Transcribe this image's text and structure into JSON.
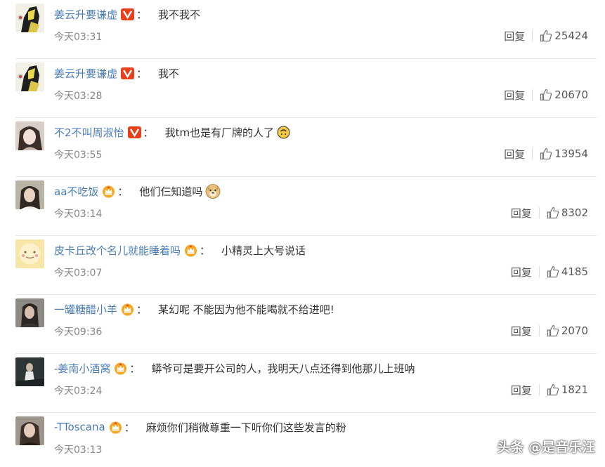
{
  "comments": [
    {
      "name": "姜云升要谦虚",
      "badge": "v-icon",
      "text": "我不我不",
      "emoji": "",
      "time": "今天03:31",
      "reply": "回复",
      "likes": "25424"
    },
    {
      "name": "姜云升要谦虚",
      "badge": "v-icon",
      "text": "我不",
      "emoji": "",
      "time": "今天03:28",
      "reply": "回复",
      "likes": "20670"
    },
    {
      "name": "不2不叫周淑怡",
      "badge": "v-icon",
      "text": "我tm也是有厂牌的人了",
      "emoji": "upside-down-face-icon",
      "time": "今天03:55",
      "reply": "回复",
      "likes": "13954"
    },
    {
      "name": "aa不吃饭",
      "badge": "crown-icon",
      "text": "他们仨知道吗",
      "emoji": "doge-icon",
      "time": "今天03:14",
      "reply": "回复",
      "likes": "8302"
    },
    {
      "name": "皮卡丘改个名儿就能睡着吗",
      "badge": "crown-icon",
      "text": "小精灵上大号说话",
      "emoji": "",
      "time": "今天03:07",
      "reply": "回复",
      "likes": "4185"
    },
    {
      "name": "一罐糖醋小羊",
      "badge": "crown-icon",
      "text": "某幻呢 不能因为他不能喝就不给进吧!",
      "emoji": "",
      "time": "今天09:36",
      "reply": "回复",
      "likes": "2070"
    },
    {
      "name": "-姜南小酒窝",
      "badge": "crown-icon",
      "text": "蟒爷可是要开公司的人，我明天八点还得到他那儿上班呐",
      "emoji": "",
      "time": "今天03:24",
      "reply": "回复",
      "likes": "1821"
    },
    {
      "name": "-TToscana",
      "badge": "crown-icon",
      "text": "麻烦你们稍微尊重一下听你们这些发言的粉",
      "emoji": "",
      "time": "今天03:13",
      "reply": "",
      "likes": ""
    }
  ],
  "colon": "：",
  "watermark": "头条 @是音乐汪",
  "colors": {
    "name": "#4a7db8",
    "badge_v": "#e8401c",
    "crown": "#f5a623"
  }
}
